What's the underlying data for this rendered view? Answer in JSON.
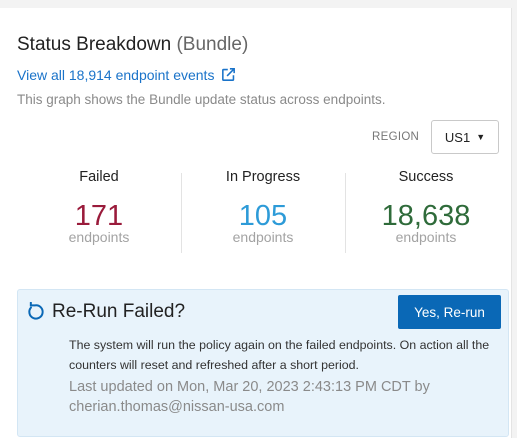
{
  "header": {
    "title": "Status Breakdown",
    "subtitle": "(Bundle)",
    "events_link": "View all 18,914 endpoint events",
    "description": "This graph shows the Bundle update status across endpoints."
  },
  "region": {
    "label": "REGION",
    "selected": "US1"
  },
  "stats": {
    "failed": {
      "label": "Failed",
      "value": "171",
      "unit": "endpoints",
      "color": "#9a1b3b"
    },
    "in_progress": {
      "label": "In Progress",
      "value": "105",
      "unit": "endpoints",
      "color": "#2d9bd8"
    },
    "success": {
      "label": "Success",
      "value": "18,638",
      "unit": "endpoints",
      "color": "#2f6b3a"
    }
  },
  "rerun": {
    "icon": "refresh-icon",
    "heading": "Re-Run Failed?",
    "button_label": "Yes, Re-run",
    "body": "The system will run the policy again on the failed endpoints. On action all the counters will reset and refreshed after a short period.",
    "last_updated": "Last updated on Mon, Mar 20, 2023 2:43:13 PM CDT by cherian.thomas@nissan-usa.com"
  },
  "colors": {
    "link": "#1a73c9",
    "button": "#0a68b6",
    "banner_bg": "#e8f3fb"
  }
}
